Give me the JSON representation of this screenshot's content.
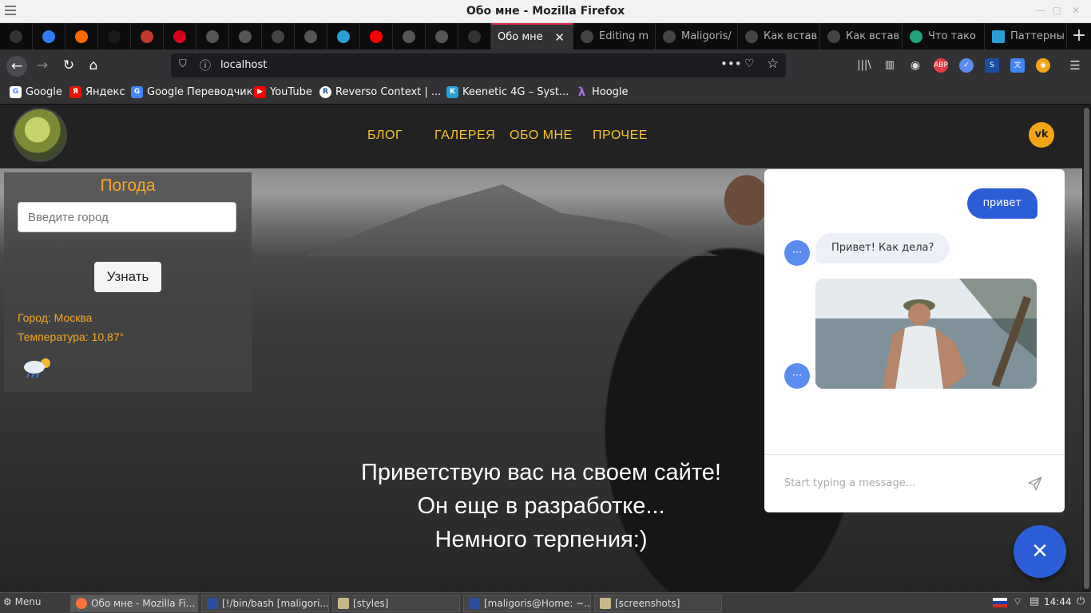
{
  "window": {
    "title": "Обо мне - Mozilla Firefox"
  },
  "tabs": {
    "pinned": [
      {
        "icon": "github-icon",
        "color": "#333"
      },
      {
        "icon": "diamond-icon",
        "color": "#2f7cf6"
      },
      {
        "icon": "chart-icon",
        "color": "#ff6a00"
      },
      {
        "icon": "g-icon",
        "color": "#1a1a1a"
      },
      {
        "icon": "spiral-icon",
        "color": "#c0392b"
      },
      {
        "icon": "hh-icon",
        "color": "#d6001c"
      },
      {
        "icon": "globe-icon",
        "color": "#555"
      },
      {
        "icon": "globe-icon",
        "color": "#555"
      },
      {
        "icon": "w-icon",
        "color": "#444"
      },
      {
        "icon": "globe-icon",
        "color": "#555"
      },
      {
        "icon": "star-icon",
        "color": "#2a9fd6"
      },
      {
        "icon": "youtube-icon",
        "color": "#ff0000"
      },
      {
        "icon": "globe-icon",
        "color": "#555"
      },
      {
        "icon": "globe-icon",
        "color": "#555"
      },
      {
        "icon": "github-icon",
        "color": "#333"
      }
    ],
    "items": [
      {
        "label": "Обо мне",
        "active": true,
        "close": "✕"
      },
      {
        "label": "Editing m",
        "icon_color": "#333"
      },
      {
        "label": "Maligoris/",
        "icon_color": "#333"
      },
      {
        "label": "Как встав",
        "icon_color": "#333"
      },
      {
        "label": "Как встав",
        "icon_color": "#333"
      },
      {
        "label": "Что тако",
        "icon_color": "#1fa37a"
      },
      {
        "label": "Паттерны",
        "icon_color": "#2a9fd6"
      }
    ],
    "new_tab": "+"
  },
  "navbar": {
    "url": "localhost"
  },
  "bookmarks": [
    {
      "label": "Google",
      "icon": "G",
      "color": "#4285f4"
    },
    {
      "label": "Яндекс",
      "icon": "Я",
      "color": "#e61400"
    },
    {
      "label": "Google Переводчик",
      "icon": "G",
      "color": "#4285f4"
    },
    {
      "label": "YouTube",
      "icon": "▶",
      "color": "#ff0000"
    },
    {
      "label": "Reverso Context | ...",
      "icon": "R",
      "color": "#1a4fa0"
    },
    {
      "label": "Keenetic 4G – Syst...",
      "icon": "K",
      "color": "#2a9fd6"
    },
    {
      "label": "Hoogle",
      "icon": "λ",
      "color": "#6a3d9a"
    }
  ],
  "site": {
    "nav": [
      "БЛОГ",
      "ГАЛЕРЕЯ",
      "ОБО МНЕ",
      "ПРОЧЕЕ"
    ],
    "vk_label": "vk",
    "welcome": [
      "Приветствую вас на своем сайте!",
      "Он еще в разработке...",
      "Немного терпения:)"
    ]
  },
  "weather": {
    "title": "Погода",
    "input_placeholder": "Введите город",
    "button": "Узнать",
    "city_label": "Город:",
    "city_value": "Москва",
    "temp_label": "Температура:",
    "temp_value": "10,87°"
  },
  "chat": {
    "user_message": "привет",
    "bot_message": "Привет! Как дела?",
    "input_placeholder": "Start typing a message...",
    "close": "✕"
  },
  "taskbar": {
    "menu": "Menu",
    "items": [
      "Обо мне - Mozilla Fi...",
      "[!/bin/bash [maligori...",
      "[styles]",
      "[maligoris@Home: ~...",
      "[screenshots]"
    ],
    "time": "14:44"
  }
}
